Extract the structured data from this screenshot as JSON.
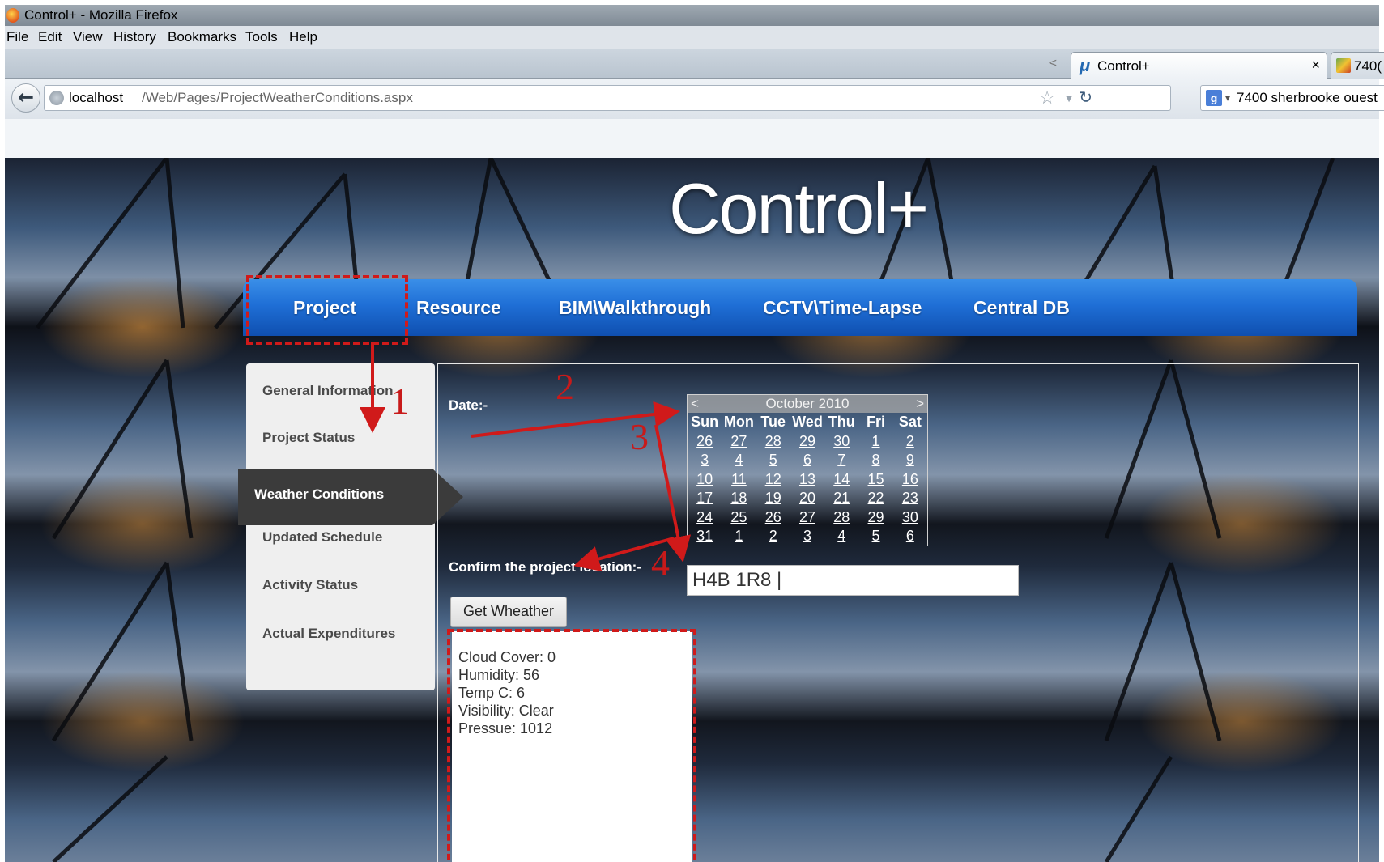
{
  "browser": {
    "window_title": "Control+ - Mozilla Firefox",
    "menu": [
      "File",
      "Edit",
      "View",
      "History",
      "Bookmarks",
      "Tools",
      "Help"
    ],
    "tabs": [
      {
        "label": "Control+",
        "active": true
      },
      {
        "label": "740("
      }
    ],
    "url_host": "localhost",
    "url_path": "/Web/Pages/ProjectWeatherConditions.aspx",
    "search_text": "7400 sherbrooke ouest"
  },
  "site": {
    "logo": "Control+",
    "nav": [
      "Project",
      "Resource",
      "BIM\\Walkthrough",
      "CCTV\\Time-Lapse",
      "Central DB"
    ],
    "side_menu": [
      "General Information",
      "Project Status",
      "Weather Conditions",
      "Updated Schedule",
      "Activity Status",
      "Actual Expenditures"
    ],
    "active_side_item": "Weather Conditions"
  },
  "form": {
    "date_label": "Date:-",
    "calendar": {
      "month_label": "October 2010",
      "prev": "<",
      "next": ">",
      "weekdays": [
        "Sun",
        "Mon",
        "Tue",
        "Wed",
        "Thu",
        "Fri",
        "Sat"
      ],
      "weeks": [
        [
          "26",
          "27",
          "28",
          "29",
          "30",
          "1",
          "2"
        ],
        [
          "3",
          "4",
          "5",
          "6",
          "7",
          "8",
          "9"
        ],
        [
          "10",
          "11",
          "12",
          "13",
          "14",
          "15",
          "16"
        ],
        [
          "17",
          "18",
          "19",
          "20",
          "21",
          "22",
          "23"
        ],
        [
          "24",
          "25",
          "26",
          "27",
          "28",
          "29",
          "30"
        ],
        [
          "31",
          "1",
          "2",
          "3",
          "4",
          "5",
          "6"
        ]
      ]
    },
    "location_label": "Confirm the project location:-",
    "location_value": "H4B 1R8",
    "get_button": "Get Wheather",
    "result": {
      "cloud_cover": "Cloud Cover: 0",
      "humidity": "Humidity: 56",
      "temp": "Temp C: 6",
      "visibility": "Visibility: Clear",
      "pressure": "Pressue: 1012"
    }
  },
  "annotations": {
    "numbers": [
      "1",
      "2",
      "3",
      "4"
    ],
    "color": "#d01a1a"
  },
  "colors": {
    "nav_blue": "#1f6fd6",
    "side_active": "#3b3b3b"
  }
}
